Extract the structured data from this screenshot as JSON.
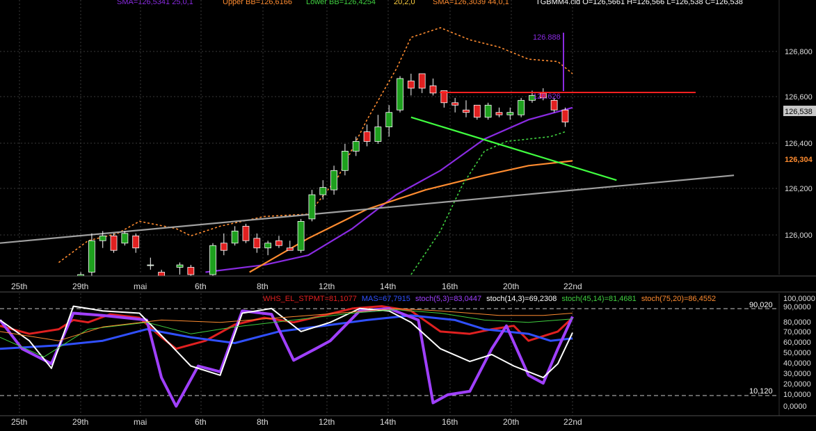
{
  "header": {
    "sma_short": "SMA=126,5341 25,0,1",
    "upper_bb": "Upper BB=126,6166",
    "lower_bb": "Lower BB=126,4254",
    "bb_params": "20,2,0",
    "sma_long": "SMA=126,3039 44,0,1",
    "ohlc": "TGBMM4.cld O=126,5661 H=126,566 L=126,538 C=126,538"
  },
  "price_panel": {
    "y_ticks": [
      "126,800",
      "126,600",
      "126,400",
      "126,200",
      "126,000"
    ],
    "last_price": "126,538",
    "sma_long_tag": "126,304",
    "target_label": "126.888",
    "resistance_label": "126.626"
  },
  "osc_panel": {
    "title": "WHS_EL_STPMT=81,1077",
    "legend": [
      {
        "text": "WHS_EL_STPMT=81,1077",
        "color": "#e02020"
      },
      {
        "text": "MAS=67,7915",
        "color": "#3050ff"
      },
      {
        "text": "stoch(5,3)=83,0447",
        "color": "#a040ff"
      },
      {
        "text": "stoch(14,3)=69,2308",
        "color": "#ffffff"
      },
      {
        "text": "stoch(45,14)=81,4681",
        "color": "#40d040"
      },
      {
        "text": "stoch(75,20)=86,4552",
        "color": "#ff8c30"
      }
    ],
    "y_ticks": [
      "100,0000",
      "90,0000",
      "80,0000",
      "70,0000",
      "60,0000",
      "50,0000",
      "40,0000",
      "30,0000",
      "20,0000",
      "10,0000",
      "0,0000"
    ],
    "upper_level": "90,020",
    "lower_level": "10,120"
  },
  "x_labels": [
    "25th",
    "29th",
    "mai",
    "6th",
    "8th",
    "12th",
    "14th",
    "16th",
    "20th",
    "22nd"
  ],
  "chart_data": [
    {
      "type": "candlestick",
      "title": "TGBMM4.cld",
      "ylim": [
        125.83,
        126.93
      ],
      "x_domain": [
        0,
        78
      ],
      "candles": [
        {
          "x": 11,
          "o": 125.8,
          "h": 125.84,
          "l": 125.78,
          "c": 125.83
        },
        {
          "x": 12.5,
          "o": 125.84,
          "h": 126.0,
          "l": 125.8,
          "c": 125.97
        },
        {
          "x": 14,
          "o": 125.97,
          "h": 126.01,
          "l": 125.94,
          "c": 125.99
        },
        {
          "x": 15.5,
          "o": 125.99,
          "h": 126.0,
          "l": 125.92,
          "c": 125.93
        },
        {
          "x": 17,
          "o": 125.96,
          "h": 126.01,
          "l": 125.95,
          "c": 126.0
        },
        {
          "x": 18.5,
          "o": 125.99,
          "h": 126.0,
          "l": 125.92,
          "c": 125.94
        },
        {
          "x": 20.5,
          "o": 125.87,
          "h": 125.9,
          "l": 125.85,
          "c": 125.87
        },
        {
          "x": 22,
          "o": 125.84,
          "h": 125.85,
          "l": 125.81,
          "c": 125.82
        },
        {
          "x": 24.5,
          "o": 125.86,
          "h": 125.88,
          "l": 125.83,
          "c": 125.87
        },
        {
          "x": 26,
          "o": 125.86,
          "h": 125.87,
          "l": 125.82,
          "c": 125.83
        },
        {
          "x": 29,
          "o": 125.83,
          "h": 125.96,
          "l": 125.82,
          "c": 125.95
        },
        {
          "x": 30.5,
          "o": 125.96,
          "h": 126.0,
          "l": 125.91,
          "c": 125.93
        },
        {
          "x": 32,
          "o": 125.96,
          "h": 126.03,
          "l": 125.95,
          "c": 126.01
        },
        {
          "x": 33.5,
          "o": 126.03,
          "h": 126.04,
          "l": 125.96,
          "c": 125.97
        },
        {
          "x": 35,
          "o": 125.98,
          "h": 126.0,
          "l": 125.92,
          "c": 125.94
        },
        {
          "x": 36.5,
          "o": 125.94,
          "h": 125.97,
          "l": 125.91,
          "c": 125.96
        },
        {
          "x": 38,
          "o": 125.97,
          "h": 125.99,
          "l": 125.94,
          "c": 125.95
        },
        {
          "x": 39.5,
          "o": 125.94,
          "h": 125.97,
          "l": 125.93,
          "c": 125.93
        },
        {
          "x": 41,
          "o": 125.93,
          "h": 126.06,
          "l": 125.92,
          "c": 126.05
        },
        {
          "x": 42.5,
          "o": 126.06,
          "h": 126.18,
          "l": 126.05,
          "c": 126.16
        },
        {
          "x": 44,
          "o": 126.16,
          "h": 126.22,
          "l": 126.14,
          "c": 126.19
        },
        {
          "x": 45.5,
          "o": 126.18,
          "h": 126.28,
          "l": 126.16,
          "c": 126.26
        },
        {
          "x": 47,
          "o": 126.26,
          "h": 126.37,
          "l": 126.24,
          "c": 126.34
        },
        {
          "x": 48.5,
          "o": 126.34,
          "h": 126.4,
          "l": 126.32,
          "c": 126.38
        },
        {
          "x": 50,
          "o": 126.42,
          "h": 126.45,
          "l": 126.36,
          "c": 126.38
        },
        {
          "x": 51.5,
          "o": 126.38,
          "h": 126.49,
          "l": 126.37,
          "c": 126.44
        },
        {
          "x": 53,
          "o": 126.44,
          "h": 126.53,
          "l": 126.4,
          "c": 126.5
        },
        {
          "x": 54.5,
          "o": 126.51,
          "h": 126.65,
          "l": 126.5,
          "c": 126.64
        },
        {
          "x": 56,
          "o": 126.63,
          "h": 126.66,
          "l": 126.57,
          "c": 126.6
        },
        {
          "x": 57.5,
          "o": 126.66,
          "h": 126.66,
          "l": 126.58,
          "c": 126.6
        },
        {
          "x": 59,
          "o": 126.61,
          "h": 126.64,
          "l": 126.57,
          "c": 126.58
        },
        {
          "x": 60.5,
          "o": 126.59,
          "h": 126.59,
          "l": 126.52,
          "c": 126.54
        },
        {
          "x": 62,
          "o": 126.54,
          "h": 126.56,
          "l": 126.5,
          "c": 126.53
        },
        {
          "x": 63.5,
          "o": 126.51,
          "h": 126.55,
          "l": 126.48,
          "c": 126.5
        },
        {
          "x": 65,
          "o": 126.53,
          "h": 126.53,
          "l": 126.47,
          "c": 126.48
        },
        {
          "x": 66.5,
          "o": 126.48,
          "h": 126.54,
          "l": 126.47,
          "c": 126.53
        },
        {
          "x": 68,
          "o": 126.5,
          "h": 126.52,
          "l": 126.48,
          "c": 126.49
        },
        {
          "x": 69.5,
          "o": 126.49,
          "h": 126.52,
          "l": 126.47,
          "c": 126.5
        },
        {
          "x": 71,
          "o": 126.49,
          "h": 126.56,
          "l": 126.48,
          "c": 126.55
        },
        {
          "x": 72.5,
          "o": 126.55,
          "h": 126.59,
          "l": 126.54,
          "c": 126.57
        },
        {
          "x": 74,
          "o": 126.58,
          "h": 126.6,
          "l": 126.55,
          "c": 126.56
        },
        {
          "x": 75.5,
          "o": 126.55,
          "h": 126.56,
          "l": 126.5,
          "c": 126.51
        },
        {
          "x": 77,
          "o": 126.51,
          "h": 126.52,
          "l": 126.44,
          "c": 126.46
        }
      ],
      "series": [
        {
          "color": "#8a2be2",
          "points": [
            [
              28,
              125.84
            ],
            [
              36,
              125.87
            ],
            [
              42,
              125.91
            ],
            [
              48,
              126.02
            ],
            [
              54,
              126.16
            ],
            [
              60,
              126.26
            ],
            [
              66,
              126.39
            ],
            [
              72,
              126.47
            ],
            [
              78,
              126.52
            ]
          ]
        },
        {
          "color": "#ff8c30",
          "points": [
            [
              34,
              125.84
            ],
            [
              42,
              125.98
            ],
            [
              50,
              126.1
            ],
            [
              58,
              126.18
            ],
            [
              66,
              126.24
            ],
            [
              72,
              126.28
            ],
            [
              78,
              126.3
            ]
          ]
        },
        {
          "color": "#ff8c30",
          "dashed": true,
          "points": [
            [
              8,
              125.88
            ],
            [
              12,
              125.97
            ],
            [
              16,
              126.0
            ],
            [
              19,
              126.05
            ],
            [
              24,
              126.02
            ],
            [
              26,
              125.99
            ],
            [
              30,
              126.03
            ],
            [
              36,
              126.07
            ],
            [
              42,
              126.08
            ],
            [
              46,
              126.23
            ],
            [
              50,
              126.47
            ],
            [
              54,
              126.68
            ],
            [
              56,
              126.81
            ],
            [
              60,
              126.85
            ],
            [
              64,
              126.8
            ],
            [
              68,
              126.77
            ],
            [
              72,
              126.72
            ],
            [
              76,
              126.71
            ],
            [
              78,
              126.66
            ]
          ]
        },
        {
          "color": "#40d040",
          "dashed": true,
          "points": [
            [
              56,
              125.83
            ],
            [
              60,
              126.01
            ],
            [
              63,
              126.2
            ],
            [
              66,
              126.34
            ],
            [
              69,
              126.38
            ],
            [
              72,
              126.39
            ],
            [
              75,
              126.4
            ],
            [
              77,
              126.42
            ]
          ]
        },
        {
          "color": "#40ff40",
          "points": [
            [
              56,
              126.48
            ],
            [
              84,
              126.22
            ]
          ]
        },
        {
          "color": "#a0a0a0",
          "points": [
            [
              0,
              125.96
            ],
            [
              100,
              126.24
            ]
          ]
        }
      ],
      "resistance": 126.626,
      "target": 126.888
    },
    {
      "type": "line",
      "title": "WHS_EL_STPMT",
      "ylim": [
        -2,
        102
      ],
      "x_domain": [
        0,
        78
      ],
      "levels": [
        90.02,
        10.12
      ],
      "series": [
        {
          "name": "WHS_EL_STPMT",
          "color": "#e02020",
          "values": [
            [
              0,
              75
            ],
            [
              4,
              68
            ],
            [
              8,
              72
            ],
            [
              10,
              80
            ],
            [
              12,
              78
            ],
            [
              15,
              85
            ],
            [
              19,
              82
            ],
            [
              22,
              65
            ],
            [
              24,
              55
            ],
            [
              28,
              62
            ],
            [
              32,
              76
            ],
            [
              36,
              82
            ],
            [
              40,
              78
            ],
            [
              44,
              84
            ],
            [
              48,
              90
            ],
            [
              52,
              92
            ],
            [
              56,
              88
            ],
            [
              60,
              70
            ],
            [
              64,
              68
            ],
            [
              67,
              72
            ],
            [
              70,
              75
            ],
            [
              72,
              62
            ],
            [
              76,
              70
            ],
            [
              78,
              82
            ]
          ]
        },
        {
          "name": "MAS",
          "color": "#3050ff",
          "values": [
            [
              0,
              55
            ],
            [
              8,
              58
            ],
            [
              14,
              62
            ],
            [
              20,
              72
            ],
            [
              26,
              65
            ],
            [
              32,
              60
            ],
            [
              38,
              70
            ],
            [
              44,
              75
            ],
            [
              50,
              80
            ],
            [
              56,
              84
            ],
            [
              62,
              80
            ],
            [
              66,
              72
            ],
            [
              72,
              68
            ],
            [
              75,
              62
            ],
            [
              78,
              64
            ]
          ]
        },
        {
          "name": "stoch(5,3)",
          "color": "#a040ff",
          "values": [
            [
              0,
              80
            ],
            [
              3,
              55
            ],
            [
              7,
              42
            ],
            [
              10,
              86
            ],
            [
              14,
              84
            ],
            [
              20,
              80
            ],
            [
              22,
              30
            ],
            [
              24,
              5
            ],
            [
              27,
              40
            ],
            [
              30,
              35
            ],
            [
              33,
              88
            ],
            [
              37,
              85
            ],
            [
              40,
              45
            ],
            [
              43,
              55
            ],
            [
              45,
              62
            ],
            [
              49,
              88
            ],
            [
              53,
              90
            ],
            [
              57,
              80
            ],
            [
              59,
              8
            ],
            [
              61,
              15
            ],
            [
              64,
              18
            ],
            [
              67,
              55
            ],
            [
              69,
              75
            ],
            [
              72,
              32
            ],
            [
              74,
              25
            ],
            [
              76,
              55
            ],
            [
              78,
              83
            ]
          ]
        },
        {
          "name": "stoch(14,3)",
          "color": "#ffffff",
          "values": [
            [
              0,
              80
            ],
            [
              4,
              62
            ],
            [
              7,
              38
            ],
            [
              10,
              92
            ],
            [
              14,
              88
            ],
            [
              19,
              86
            ],
            [
              23,
              60
            ],
            [
              26,
              40
            ],
            [
              30,
              32
            ],
            [
              33,
              86
            ],
            [
              37,
              90
            ],
            [
              41,
              70
            ],
            [
              45,
              78
            ],
            [
              49,
              90
            ],
            [
              53,
              88
            ],
            [
              56,
              78
            ],
            [
              60,
              55
            ],
            [
              64,
              44
            ],
            [
              67,
              50
            ],
            [
              70,
              40
            ],
            [
              72,
              35
            ],
            [
              74,
              30
            ],
            [
              76,
              42
            ],
            [
              78,
              69
            ]
          ]
        },
        {
          "name": "stoch(45,14)",
          "color": "#40d040",
          "values": [
            [
              0,
              65
            ],
            [
              6,
              48
            ],
            [
              12,
              72
            ],
            [
              20,
              78
            ],
            [
              26,
              68
            ],
            [
              32,
              74
            ],
            [
              40,
              80
            ],
            [
              48,
              86
            ],
            [
              54,
              89
            ],
            [
              60,
              86
            ],
            [
              66,
              80
            ],
            [
              72,
              78
            ],
            [
              78,
              81
            ]
          ]
        },
        {
          "name": "stoch(75,20)",
          "color": "#ff8c30",
          "values": [
            [
              0,
              70
            ],
            [
              8,
              62
            ],
            [
              14,
              74
            ],
            [
              22,
              80
            ],
            [
              30,
              78
            ],
            [
              38,
              82
            ],
            [
              46,
              86
            ],
            [
              54,
              90
            ],
            [
              60,
              88
            ],
            [
              68,
              84
            ],
            [
              74,
              84
            ],
            [
              78,
              86
            ]
          ]
        }
      ]
    }
  ]
}
